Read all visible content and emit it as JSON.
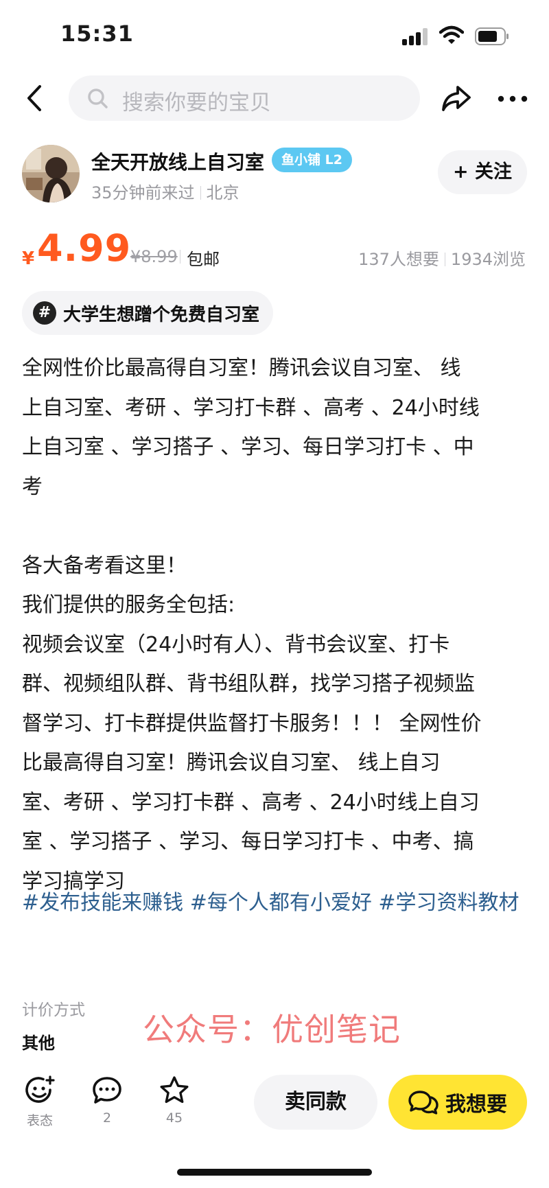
{
  "status_bar": {
    "time": "15:31"
  },
  "search": {
    "placeholder": "搜索你要的宝贝"
  },
  "seller": {
    "name": "全天开放线上自习室",
    "badge": "鱼小铺 L2",
    "last_seen": "35分钟前来过",
    "location": "北京",
    "follow_label": "+ 关注"
  },
  "price": {
    "currency": "¥",
    "current": "4.99",
    "original": "¥8.99",
    "shipping": "包邮",
    "wants": "137人想要",
    "views": "1934浏览"
  },
  "topic": {
    "icon": "#",
    "text": "大学生想蹭个免费自习室"
  },
  "description": "全网性价比最高得自习室！腾讯会议自习室、 线\n上自习室、考研 、学习打卡群 、高考 、24小时线\n上自习室 、学习搭子 、学习、每日学习打卡 、中\n考\n\n各大备考看这里！\n我们提供的服务全包括:\n视频会议室（24小时有人）、背书会议室、打卡\n群、视频组队群、背书组队群，找学习搭子视频监\n督学习、打卡群提供监督打卡服务！！！ 全网性价\n比最高得自习室！腾讯会议自习室、 线上自习\n室、考研 、学习打卡群 、高考 、24小时线上自习\n室 、学习搭子 、学习、每日学习打卡 、中考、搞\n学习搞学习",
  "tags": [
    "#发布技能来赚钱",
    "#每个人都有小爱好",
    "#学习资料教材"
  ],
  "pricing": {
    "label": "计价方式",
    "value": "其他"
  },
  "watermark": "公众号：优创笔记",
  "bottom_bar": {
    "react_label": "表态",
    "comment_count": "2",
    "favorite_count": "45",
    "same_label": "卖同款",
    "want_label": "我想要"
  },
  "colors": {
    "price": "#ff5a1f",
    "badge": "#5cc8f2",
    "want_button": "#ffe433",
    "tag": "#2d5f8f",
    "watermark": "#f07b7b"
  },
  "icons": [
    "signal-icon",
    "wifi-icon",
    "battery-icon",
    "back-icon",
    "search-icon",
    "share-icon",
    "more-icon",
    "emoji-icon",
    "comment-icon",
    "star-icon",
    "chat-icon"
  ]
}
